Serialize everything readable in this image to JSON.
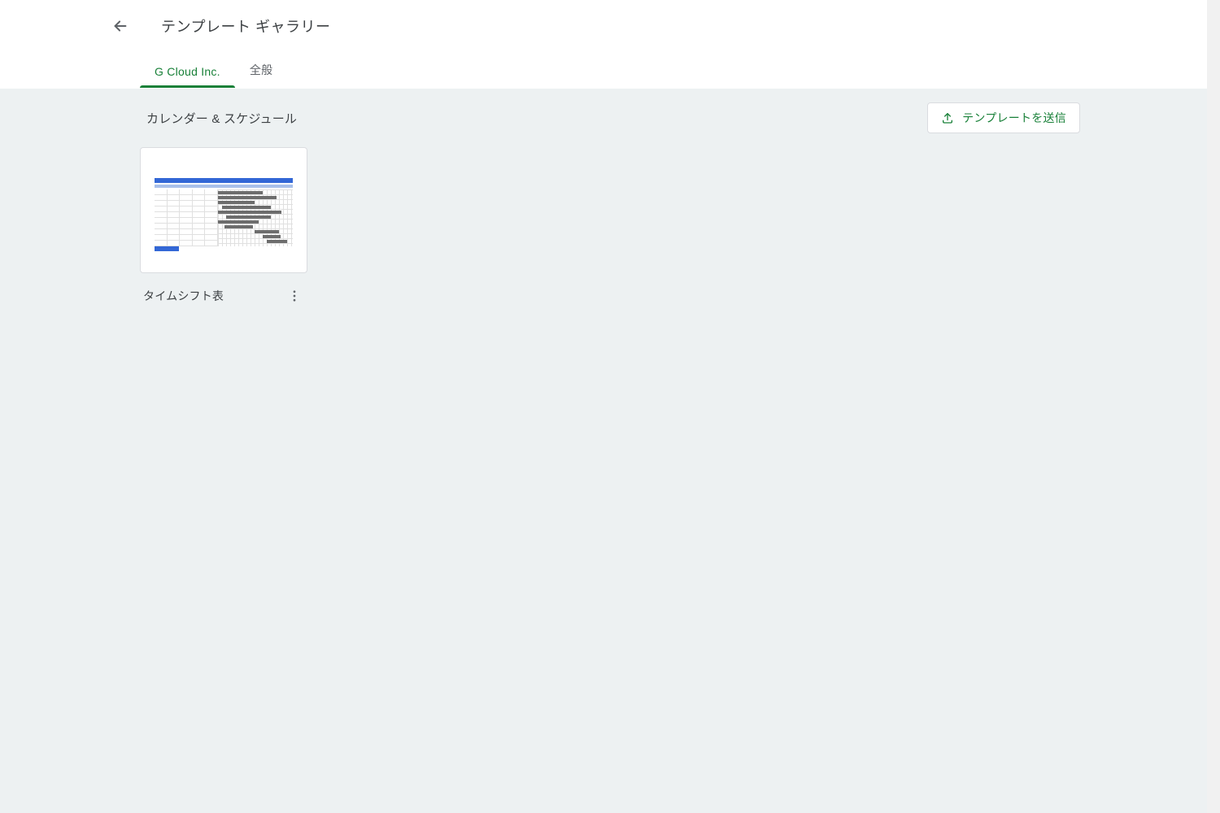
{
  "header": {
    "title": "テンプレート ギャラリー",
    "tabs": [
      {
        "label": "G Cloud Inc.",
        "active": true
      },
      {
        "label": "全般",
        "active": false
      }
    ]
  },
  "section": {
    "title": "カレンダー & スケジュール",
    "submit_label": "テンプレートを送信"
  },
  "templates": [
    {
      "title": "タイムシフト表"
    }
  ]
}
